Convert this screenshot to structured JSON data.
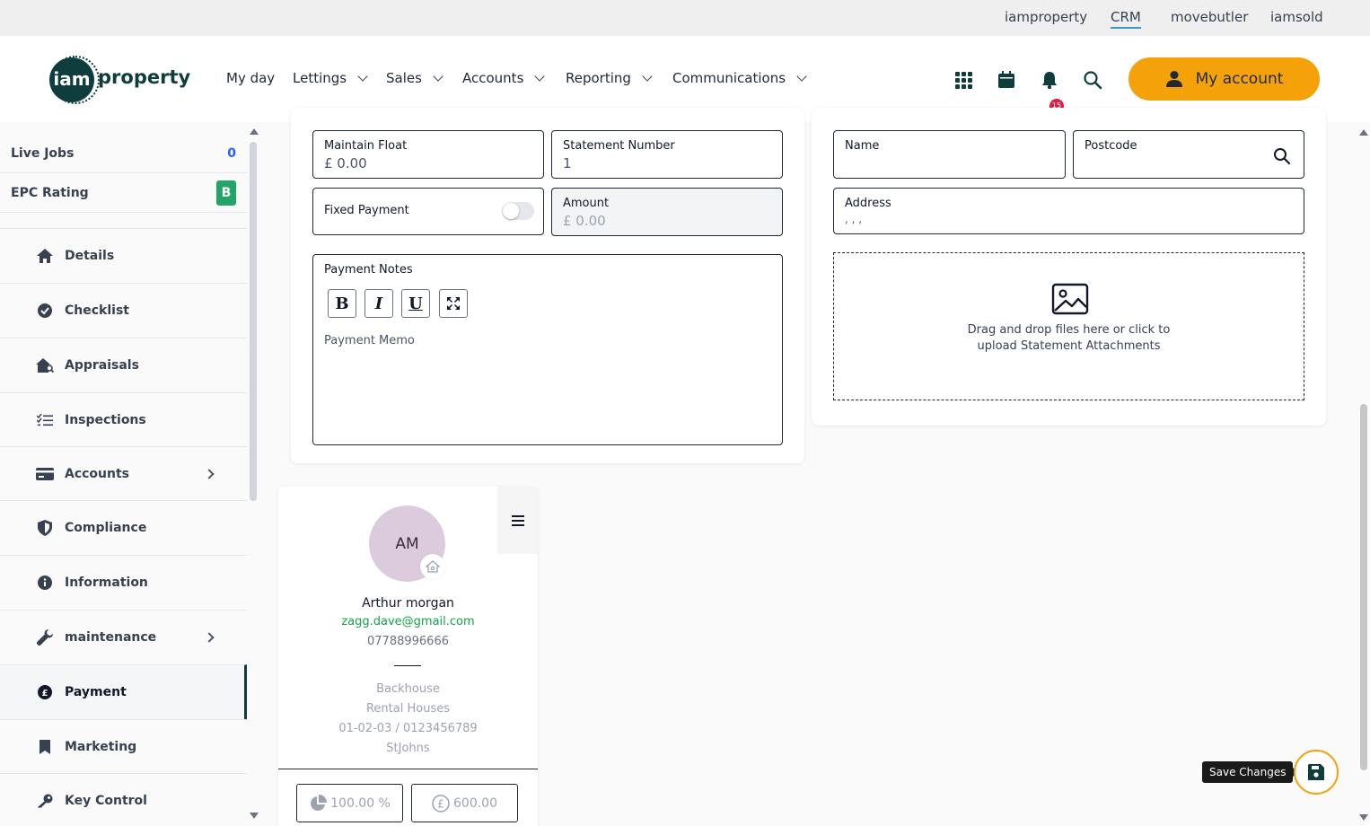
{
  "brand_links": [
    {
      "label": "iamproperty",
      "active": false
    },
    {
      "label": "CRM",
      "active": true
    },
    {
      "label": "movebutler",
      "active": false
    },
    {
      "label": "iamsold",
      "active": false
    }
  ],
  "logo": {
    "mark": "iam",
    "word": "property"
  },
  "nav": {
    "my_day": "My day",
    "lettings": "Lettings",
    "sales": "Sales",
    "accounts": "Accounts",
    "reporting": "Reporting",
    "communications": "Communications"
  },
  "notifications": {
    "count": "15"
  },
  "account": {
    "label": "My account"
  },
  "sidebar": {
    "live_jobs": {
      "label": "Live Jobs",
      "value": "0"
    },
    "epc": {
      "label": "EPC Rating",
      "value": "B"
    },
    "items": [
      {
        "label": "Details",
        "icon": "home-icon"
      },
      {
        "label": "Checklist",
        "icon": "check-circle-icon"
      },
      {
        "label": "Appraisals",
        "icon": "house-search-icon"
      },
      {
        "label": "Inspections",
        "icon": "list-check-icon"
      },
      {
        "label": "Accounts",
        "icon": "credit-card-icon"
      },
      {
        "label": "Compliance",
        "icon": "shield-icon"
      },
      {
        "label": "Information",
        "icon": "info-icon"
      },
      {
        "label": "maintenance",
        "icon": "wrench-icon"
      },
      {
        "label": "Payment",
        "icon": "pound-icon"
      },
      {
        "label": "Marketing",
        "icon": "bookmark-icon"
      },
      {
        "label": "Key Control",
        "icon": "key-icon"
      }
    ]
  },
  "payment_form": {
    "maintain_float": {
      "label": "Maintain Float",
      "value": "£ 0.00"
    },
    "statement_number": {
      "label": "Statement Number",
      "value": "1"
    },
    "fixed_payment": {
      "label": "Fixed Payment",
      "enabled": false
    },
    "amount": {
      "label": "Amount",
      "value": "£ 0.00"
    },
    "notes": {
      "label": "Payment Notes",
      "placeholder": "Payment Memo",
      "bold": "B",
      "italic": "I",
      "underline": "U"
    }
  },
  "payee_form": {
    "name": {
      "label": "Name",
      "value": ""
    },
    "postcode": {
      "label": "Postcode",
      "value": ""
    },
    "address": {
      "label": "Address",
      "value": ", , ,"
    },
    "dropzone_text": "Drag and drop files here or click to upload Statement Attachments"
  },
  "contact": {
    "initials": "AM",
    "name": "Arthur morgan",
    "email": "zagg.dave@gmail.com",
    "phone": "07788996666",
    "address_lines": [
      "Backhouse",
      "Rental Houses",
      "01-02-03 / 0123456789",
      "StJohns"
    ],
    "share": "100.00 %",
    "amount": "600.00"
  },
  "save": {
    "tooltip": "Save Changes"
  },
  "colors": {
    "accent": "#f5a20a",
    "brand_dark": "#0f3d3e",
    "epc_green": "#22a565",
    "link_green": "#16a34a",
    "badge_red": "#e11d48"
  }
}
